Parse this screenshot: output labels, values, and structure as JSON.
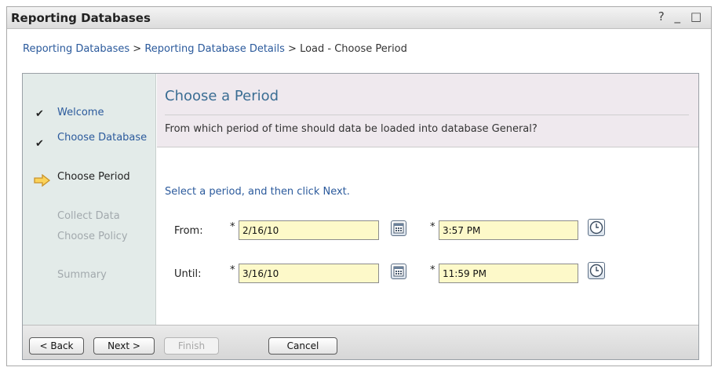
{
  "window": {
    "title": "Reporting Databases",
    "help_glyph": "?",
    "minimize_glyph": "_",
    "maximize_glyph": "□"
  },
  "breadcrumb": {
    "items": [
      "Reporting Databases",
      "Reporting Database Details",
      "Load - Choose Period"
    ],
    "separator": ">"
  },
  "steps": [
    {
      "label": "Welcome",
      "state": "done"
    },
    {
      "label": "Choose Database",
      "state": "done"
    },
    {
      "label": "Choose Period",
      "state": "current"
    },
    {
      "label": "Collect Data",
      "state": "future"
    },
    {
      "label": "Choose Policy",
      "state": "future"
    },
    {
      "label": "Summary",
      "state": "future"
    }
  ],
  "content": {
    "title": "Choose a Period",
    "question": "From which period of time should data be loaded into database General?",
    "instruction": "Select a period, and then click Next."
  },
  "form": {
    "from_label": "From:",
    "until_label": "Until:",
    "required_marker": "*",
    "from_date": "2/16/10",
    "from_time": "3:57 PM",
    "until_date": "3/16/10",
    "until_time": "11:59 PM"
  },
  "buttons": {
    "back": "< Back",
    "next": "Next >",
    "finish": "Finish",
    "cancel": "Cancel"
  },
  "icons": {
    "check": "check-icon",
    "current_step": "arrow-right-icon",
    "calendar": "calendar-icon",
    "clock": "clock-icon"
  },
  "colors": {
    "link": "#2b5a9c",
    "title": "#3a6d93",
    "field_background": "#fdf9c9",
    "current_arrow": "#e8b430",
    "nav_background": "#e3ebe9",
    "header_background": "#efe9ee"
  }
}
